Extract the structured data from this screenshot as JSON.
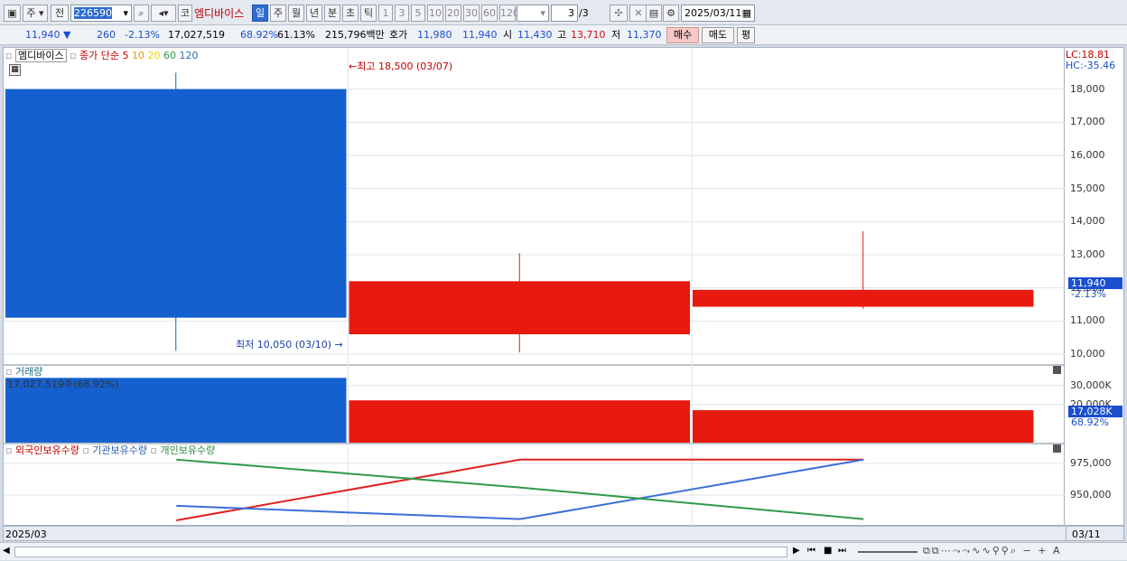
{
  "toolbar": {
    "stock_type": "주",
    "prev_label": "전",
    "stock_code": "226590",
    "market_badge": "코",
    "stock_name": "엠디바이스",
    "period_day": "일",
    "period_week": "주",
    "period_month": "월",
    "period_year": "년",
    "period_minute": "분",
    "period_second": "초",
    "period_tick": "틱",
    "intervals": [
      "1",
      "3",
      "5",
      "10",
      "20",
      "30",
      "60",
      "120"
    ],
    "page_counter": "3",
    "page_total": "/3",
    "date": "2025/03/11"
  },
  "quote": {
    "price": "11,940",
    "change": "260",
    "change_pct": "-2.13%",
    "volume": "17,027,519",
    "vol_ratio1": "68.92%",
    "vol_ratio2": "61.13%",
    "amount": "215,796백만",
    "hoga_label": "호가",
    "ask": "11,980",
    "bid": "11,940",
    "open_label": "시",
    "open": "11,430",
    "high_label": "고",
    "high": "13,710",
    "low_label": "저",
    "low": "11,370",
    "buy_label": "매수",
    "sell_label": "매도",
    "eval_label": "평"
  },
  "price_panel": {
    "name": "엠디바이스",
    "ma_label": "종가 단순",
    "ma_periods": [
      "5",
      "10",
      "20",
      "60",
      "120"
    ],
    "high_marker": "최고 18,500 (03/07)",
    "low_marker": "최저 10,050 (03/10)",
    "lc_label": "LC:18.81",
    "hc_label": "HC:-35.46",
    "current_price": "11,940",
    "current_pct": "-2.13%",
    "y_ticks": [
      "18,000",
      "17,000",
      "16,000",
      "15,000",
      "14,000",
      "13,000",
      "12,000",
      "11,000",
      "10,000"
    ]
  },
  "volume_panel": {
    "title": "거래량",
    "value_label": "17,027,519주(68.92%)",
    "y_ticks": [
      "30,000K",
      "20,000K"
    ],
    "current": "17,028K",
    "current_pct": "68.92%"
  },
  "holding_panel": {
    "legend": [
      "외국인보유수량",
      "기관보유수량",
      "개인보유수량"
    ],
    "y_ticks": [
      "975,000",
      "950,000"
    ]
  },
  "date_axis": {
    "left": "2025/03",
    "right": "03/11"
  },
  "colors": {
    "up": "#e8190f",
    "down": "#1560cf",
    "foreign": "#e02020",
    "institution": "#3a6fd8",
    "individual": "#2e9a4a"
  },
  "chart_data": [
    {
      "type": "candlestick",
      "categories": [
        "03/07",
        "03/10",
        "03/11"
      ],
      "open": [
        18000,
        10600,
        11430
      ],
      "high": [
        18500,
        13050,
        13710
      ],
      "low": [
        10100,
        10050,
        11370
      ],
      "close": [
        11100,
        12200,
        11940
      ],
      "ylim": [
        9700,
        18700
      ]
    },
    {
      "type": "bar",
      "title": "거래량",
      "categories": [
        "03/07",
        "03/10",
        "03/11"
      ],
      "values": [
        34000,
        22200,
        17028
      ],
      "ylim": [
        0,
        36500
      ]
    },
    {
      "type": "line",
      "categories": [
        "03/07",
        "03/10",
        "03/11"
      ],
      "series": [
        {
          "name": "외국인보유수량",
          "values": [
            930000,
            978000,
            978000
          ]
        },
        {
          "name": "기관보유수량",
          "values": [
            941500,
            931000,
            978000
          ]
        },
        {
          "name": "개인보유수량",
          "values": [
            978000,
            956000,
            931000
          ]
        }
      ],
      "ylim": [
        925000,
        985000
      ]
    }
  ]
}
